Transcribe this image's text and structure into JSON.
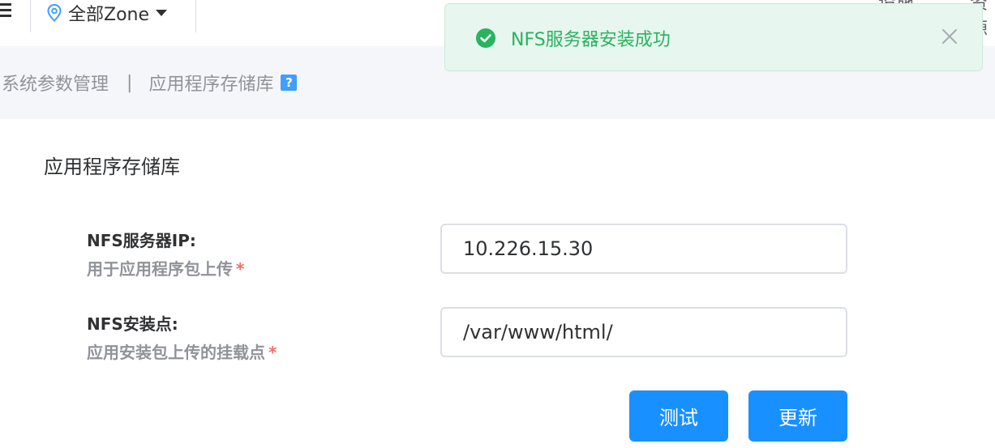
{
  "topbar": {
    "zone_label": "全部Zone",
    "right_clip_1": "设施",
    "right_clip_2": "资源"
  },
  "breadcrumb": {
    "parent": "系统参数管理",
    "divider": "|",
    "current": "应用程序存储库",
    "help_glyph": "?"
  },
  "toast": {
    "message": "NFS服务器安装成功",
    "status_color": "#29b35f"
  },
  "form": {
    "title": "应用程序存储库",
    "nfs_ip": {
      "label": "NFS服务器IP:",
      "sublabel": "用于应用程序包上传",
      "required_mark": "*",
      "value": "10.226.15.30"
    },
    "nfs_mount": {
      "label": "NFS安装点:",
      "sublabel": "应用安装包上传的挂载点",
      "required_mark": "*",
      "value": "/var/www/html/"
    },
    "test_label": "测试",
    "update_label": "更新"
  },
  "colors": {
    "primary": "#1890ff",
    "success": "#29b35f",
    "required": "#f56c6c"
  }
}
